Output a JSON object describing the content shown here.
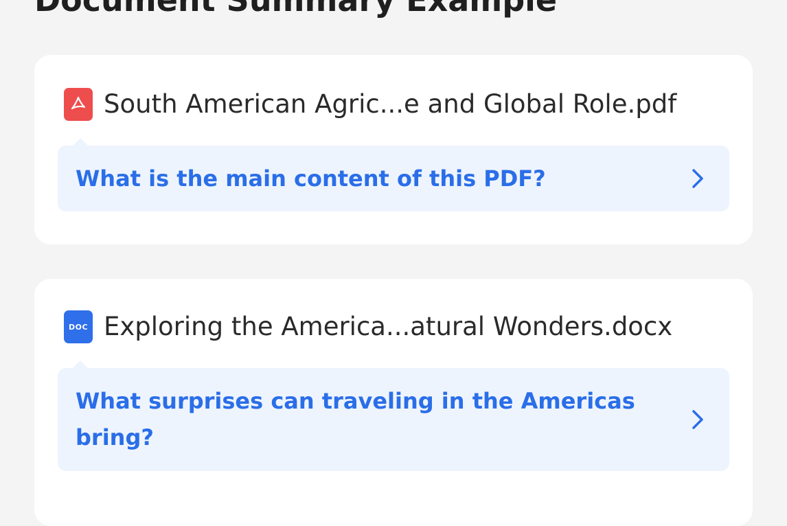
{
  "section": {
    "title": "Document Summary Example"
  },
  "cards": [
    {
      "file_type_icon": "pdf-icon",
      "file_icon_color": "#ee4d4d",
      "file_name": "South American Agric...e and Global Role.pdf",
      "question": "What is the main content of this PDF?"
    },
    {
      "file_type_icon": "docx-icon",
      "file_icon_color": "#2f6fea",
      "file_icon_label": "DOC",
      "file_name": "Exploring the America...atural Wonders.docx",
      "question": "What surprises can traveling in the Americas bring?"
    }
  ],
  "colors": {
    "background": "#f4f4f5",
    "card": "#ffffff",
    "question_background": "#eef4fe",
    "accent": "#2a6ee8"
  }
}
